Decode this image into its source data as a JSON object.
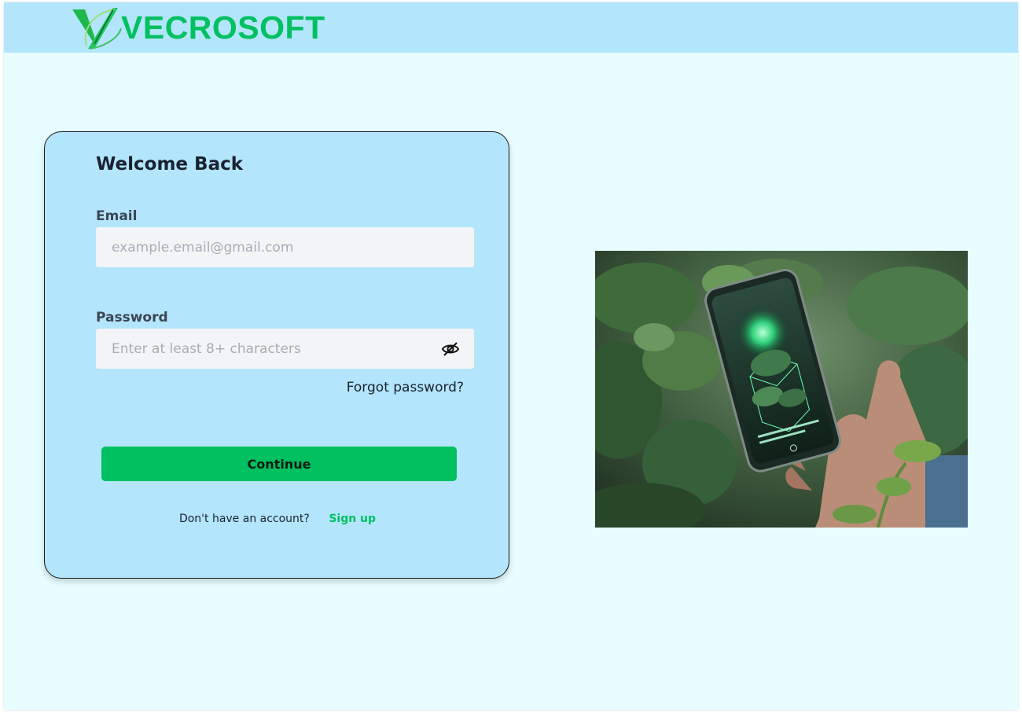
{
  "brand": {
    "name": "VECROSOFT",
    "color": "#00c060",
    "logo_icon": "check-v-logo-icon"
  },
  "login": {
    "title": "Welcome Back",
    "email": {
      "label": "Email",
      "placeholder": "example.email@gmail.com",
      "value": ""
    },
    "password": {
      "label": "Password",
      "placeholder": "Enter at least 8+ characters",
      "value": "",
      "toggle_icon": "eye-slash-icon"
    },
    "forgot_label": "Forgot password?",
    "continue_label": "Continue",
    "signup_prompt": "Don't have an account?",
    "signup_label": "Sign up"
  },
  "hero": {
    "subject": "hand-holding-phone-with-plants-image"
  },
  "colors": {
    "topbar": "#b3e5fc",
    "page": "#e8fdff",
    "card": "#b3e5fc",
    "accent": "#00c060"
  }
}
